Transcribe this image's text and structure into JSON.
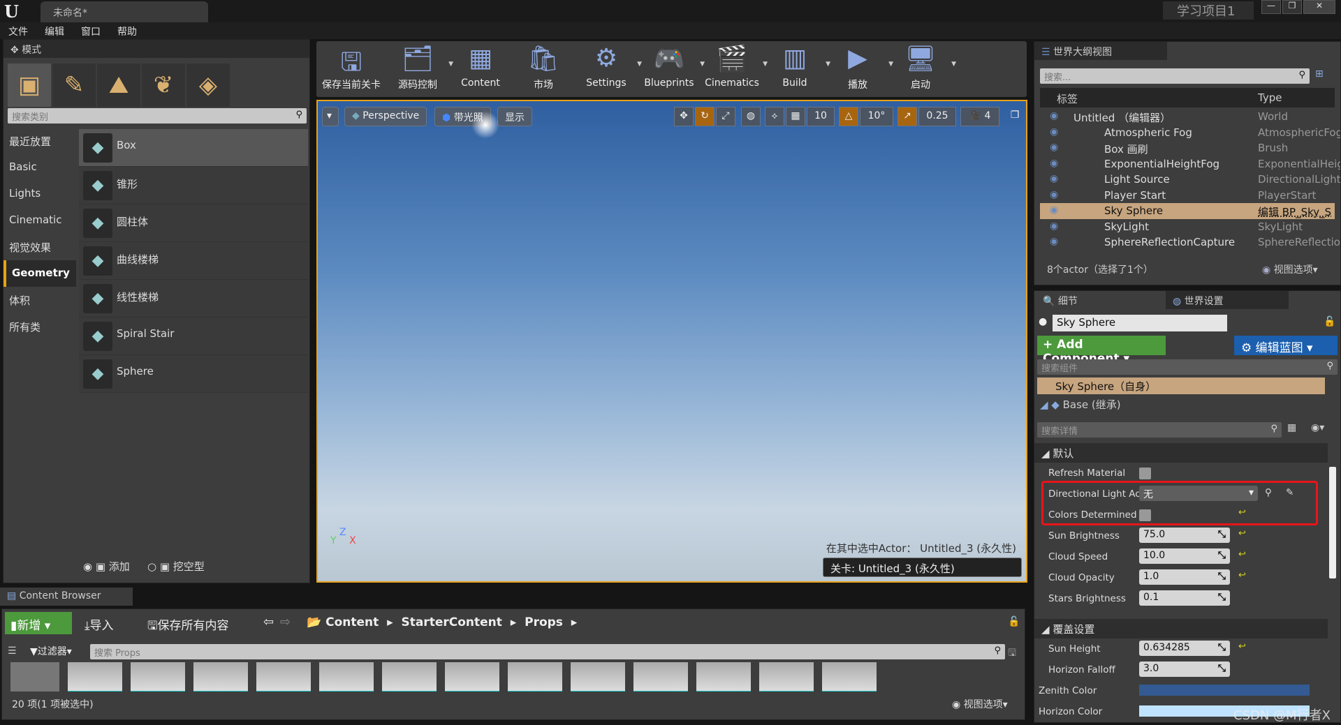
{
  "window": {
    "title": "未命名*",
    "project": "学习项目1",
    "controls": [
      "—",
      "❐",
      "✕"
    ]
  },
  "menu": [
    "文件",
    "编辑",
    "窗口",
    "帮助"
  ],
  "modes": {
    "tab": "模式",
    "search_placeholder": "搜索类别",
    "categories": [
      "最近放置",
      "Basic",
      "Lights",
      "Cinematic",
      "视觉效果",
      "Geometry",
      "体积",
      "所有类"
    ],
    "selected_category": "Geometry",
    "items": [
      {
        "label": "Box",
        "icon": "cube-icon"
      },
      {
        "label": "锥形",
        "icon": "cone-icon"
      },
      {
        "label": "圆柱体",
        "icon": "cylinder-icon"
      },
      {
        "label": "曲线楼梯",
        "icon": "curved-stair-icon"
      },
      {
        "label": "线性楼梯",
        "icon": "linear-stair-icon"
      },
      {
        "label": "Spiral Stair",
        "icon": "spiral-stair-icon"
      },
      {
        "label": "Sphere",
        "icon": "sphere-icon"
      }
    ],
    "add_label": "添加",
    "subtract_label": "挖空型"
  },
  "toolbar": [
    {
      "label": "保存当前关卡",
      "icon": "save-icon",
      "dd": false
    },
    {
      "label": "源码控制",
      "icon": "source-control-icon",
      "dd": true
    },
    {
      "label": "Content",
      "icon": "content-icon",
      "dd": false
    },
    {
      "label": "市场",
      "icon": "marketplace-icon",
      "dd": false
    },
    {
      "label": "Settings",
      "icon": "settings-icon",
      "dd": true
    },
    {
      "label": "Blueprints",
      "icon": "blueprints-icon",
      "dd": true
    },
    {
      "label": "Cinematics",
      "icon": "cinematics-icon",
      "dd": true
    },
    {
      "label": "Build",
      "icon": "build-icon",
      "dd": true
    },
    {
      "label": "播放",
      "icon": "play-icon",
      "dd": true
    },
    {
      "label": "启动",
      "icon": "launch-icon",
      "dd": true
    }
  ],
  "viewport": {
    "perspective": "Perspective",
    "lit": "带光照",
    "show": "显示",
    "grid_snap": "10",
    "rot_snap": "10°",
    "scale_snap": "0.25",
    "cam_speed": "4",
    "selected_actor": "在其中选中Actor： Untitled_3 (永久性)",
    "level": "关卡: Untitled_3 (永久性)",
    "axes": {
      "y": "Y",
      "z": "Z",
      "x": "X"
    }
  },
  "outliner": {
    "tab": "世界大纲视图",
    "search_placeholder": "搜索...",
    "col_label": "标签",
    "col_type": "Type",
    "rows": [
      {
        "name": "Untitled （编辑器）",
        "type": "World"
      },
      {
        "name": "Atmospheric Fog",
        "type": "AtmosphericFog"
      },
      {
        "name": "Box 画刷",
        "type": "Brush"
      },
      {
        "name": "ExponentialHeightFog",
        "type": "ExponentialHeig"
      },
      {
        "name": "Light Source",
        "type": "DirectionalLight"
      },
      {
        "name": "Player Start",
        "type": "PlayerStart"
      },
      {
        "name": "Sky Sphere",
        "type": "编辑 BP_Sky_S",
        "selected": true
      },
      {
        "name": "SkyLight",
        "type": "SkyLight"
      },
      {
        "name": "SphereReflectionCapture",
        "type": "SphereReflectior"
      }
    ],
    "status": "8个actor（选择了1个）",
    "view_options": "视图选项"
  },
  "details": {
    "tab": "细节",
    "tab2": "世界设置",
    "actor_name": "Sky Sphere",
    "add_component": "+ Add Component",
    "edit_blueprint": "编辑蓝图",
    "search_components": "搜索组件",
    "self": "Sky Sphere（自身）",
    "base": "Base (继承)",
    "search_details": "搜索详情",
    "section_default": "默认",
    "props": [
      {
        "label": "Refresh Material",
        "type": "check"
      },
      {
        "label": "Directional Light Ac",
        "type": "select",
        "value": "无"
      },
      {
        "label": "Colors Determined",
        "type": "check",
        "reset": true
      },
      {
        "label": "Sun Brightness",
        "value": "75.0",
        "reset": true
      },
      {
        "label": "Cloud Speed",
        "value": "10.0",
        "reset": true
      },
      {
        "label": "Cloud Opacity",
        "value": "1.0",
        "reset": true
      },
      {
        "label": "Stars Brightness",
        "value": "0.1"
      }
    ],
    "section_override": "覆盖设置",
    "props2": [
      {
        "label": "Sun Height",
        "value": "0.634285",
        "reset": true
      },
      {
        "label": "Horizon Falloff",
        "value": "3.0"
      },
      {
        "label": "Zenith Color",
        "type": "color",
        "color": "#335a92"
      },
      {
        "label": "Horizon Color",
        "type": "color",
        "color": "#bfe3ff"
      }
    ]
  },
  "content_browser": {
    "tab": "Content Browser",
    "new": "新增",
    "import": "导入",
    "save_all": "保存所有内容",
    "path": [
      "Content",
      "StarterContent",
      "Props"
    ],
    "filter": "过滤器",
    "search_placeholder": "搜索 Props",
    "status": "20 项(1 项被选中)",
    "view_options": "视图选项",
    "thumb_count": 14
  },
  "watermark": "CSDN @M行者X",
  "colors": {
    "accent": "#e8a217",
    "selection": "#c7a57f",
    "add_component": "#4c9a3c",
    "edit_blueprint": "#1b5fae",
    "highlight_box": "#e8141a"
  }
}
